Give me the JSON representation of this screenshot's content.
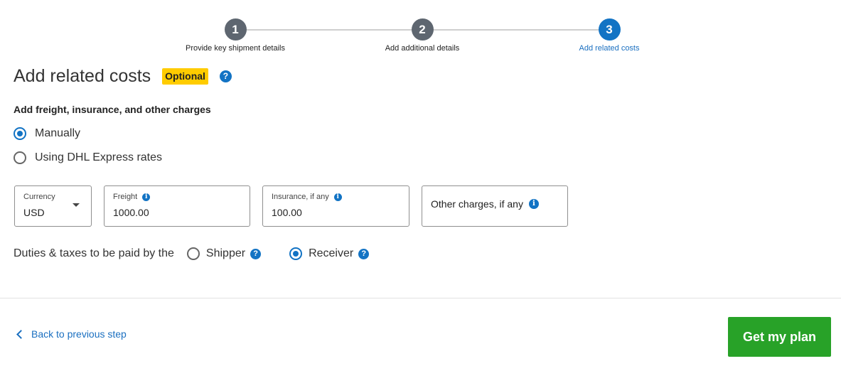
{
  "stepper": {
    "steps": [
      {
        "number": "1",
        "label": "Provide key shipment details"
      },
      {
        "number": "2",
        "label": "Add additional details"
      },
      {
        "number": "3",
        "label": "Add related costs"
      }
    ],
    "active_step": 3,
    "colors": {
      "active": "#1273c4",
      "inactive": "#5e6670"
    }
  },
  "header": {
    "title": "Add related costs",
    "badge": "Optional",
    "help_icon": "?"
  },
  "charges": {
    "section_label": "Add freight, insurance, and other charges",
    "options": [
      {
        "label": "Manually",
        "checked": true
      },
      {
        "label": "Using DHL Express rates",
        "checked": false
      }
    ]
  },
  "fields": {
    "currency": {
      "label": "Currency",
      "value": "USD"
    },
    "freight": {
      "label": "Freight",
      "value": "1000.00",
      "info_icon": "i"
    },
    "insurance": {
      "label": "Insurance, if any",
      "value": "100.00",
      "info_icon": "i"
    },
    "other": {
      "label": "Other charges, if any",
      "info_icon": "i"
    }
  },
  "duties": {
    "label": "Duties & taxes to be paid by the",
    "options": [
      {
        "label": "Shipper",
        "checked": false
      },
      {
        "label": "Receiver",
        "checked": true
      }
    ],
    "help_icon": "?"
  },
  "footer": {
    "back_label": "Back to previous step",
    "primary_label": "Get my plan",
    "primary_color": "#28a228"
  }
}
